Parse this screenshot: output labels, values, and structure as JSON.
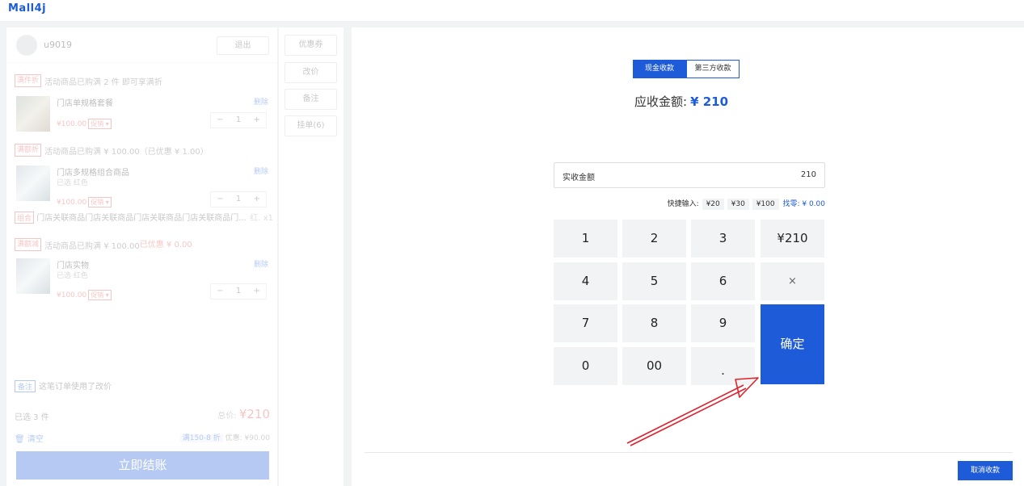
{
  "app": {
    "logo": "Mall4j"
  },
  "cart": {
    "username": "u9019",
    "logout_label": "退出",
    "promos": [
      {
        "tag": "满件折",
        "text": "活动商品已购满 2 件 即可享满折",
        "extra": ""
      },
      {
        "tag": "满额折",
        "text": "活动商品已购满 ¥ 100.00（已优惠 ¥ 1.00）",
        "extra": ""
      },
      {
        "tag": "满额减",
        "text": "活动商品已购满 ¥ 100.00",
        "extra": "已优惠 ¥ 0.00"
      }
    ],
    "items": [
      {
        "name": "门店单规格套餐",
        "spec": "",
        "price": "¥100.00",
        "promo_select": "促销 ▾",
        "delete_label": "删除",
        "qty": "1"
      },
      {
        "name": "门店多规格组合商品",
        "spec": "已选 红色",
        "price": "¥100.00",
        "promo_select": "促销 ▾",
        "delete_label": "删除",
        "qty": "1"
      },
      {
        "name": "门店实物",
        "spec": "已选 红色",
        "price": "¥100.00",
        "promo_select": "促销 ▾",
        "delete_label": "删除",
        "qty": "1"
      }
    ],
    "combo": {
      "tag": "组合",
      "name": "门店关联商品门店关联商品门店关联商品门店关联商品门...",
      "spec": "红.",
      "qty": "x1"
    },
    "note_tag": "备注",
    "note_text": "这笔订单使用了改价",
    "selected_count": "已选 3 件",
    "total_label": "总价:",
    "total_value": "¥210",
    "clear_label": "清空",
    "discount_tag": "满150-8 折",
    "discount_text": "优惠: ¥90.00",
    "checkout_label": "立即结账"
  },
  "side_actions": [
    "优惠券",
    "改价",
    "备注",
    "挂单(6)"
  ],
  "payment": {
    "tabs": [
      {
        "label": "现金收款",
        "active": true
      },
      {
        "label": "第三方收款",
        "active": false
      }
    ],
    "due_label": "应收金额:",
    "due_value": "¥ 210",
    "received_label": "实收金额",
    "received_value": "210",
    "quick_label": "快捷输入:",
    "quick_values": [
      "¥20",
      "¥30",
      "¥100"
    ],
    "change_label": "找零: ¥ 0.00",
    "keys": [
      "1",
      "2",
      "3",
      "¥210",
      "4",
      "5",
      "6",
      "×",
      "7",
      "8",
      "9",
      "0",
      "00",
      "."
    ],
    "confirm_label": "确定",
    "cancel_label": "取消收款"
  },
  "colors": {
    "accent": "#1d5bd8",
    "danger": "#e34d4d",
    "annotation_arrow": "#e0202a"
  }
}
